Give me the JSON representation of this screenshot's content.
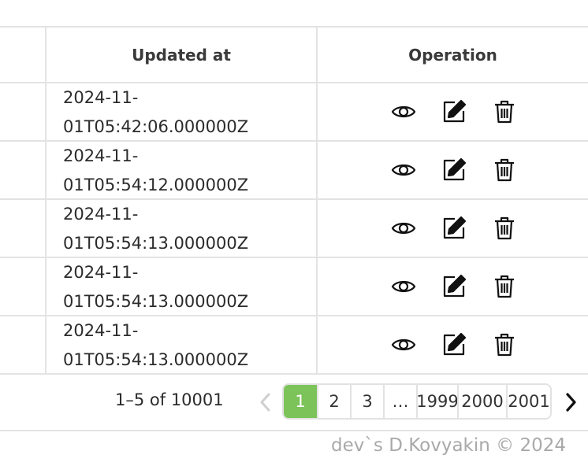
{
  "table": {
    "columns": {
      "updated_at": "Updated at",
      "operation": "Operation"
    },
    "rows": [
      {
        "updated_line1": "2024-11-",
        "updated_line2": "01T05:42:06.000000Z"
      },
      {
        "updated_line1": "2024-11-",
        "updated_line2": "01T05:54:12.000000Z"
      },
      {
        "updated_line1": "2024-11-",
        "updated_line2": "01T05:54:13.000000Z"
      },
      {
        "updated_line1": "2024-11-",
        "updated_line2": "01T05:54:13.000000Z"
      },
      {
        "updated_line1": "2024-11-",
        "updated_line2": "01T05:54:13.000000Z"
      }
    ],
    "operation_icons": [
      "eye-icon",
      "edit-icon",
      "trash-icon"
    ]
  },
  "pagination": {
    "range_text": "1–5 of 10001",
    "pages": [
      "1",
      "2",
      "3",
      "…",
      "1999",
      "2000",
      "2001"
    ],
    "active_page": "1",
    "active_color": "#7cc35a"
  },
  "footer": {
    "text": "dev`s D.Kovyakin © 2024"
  }
}
